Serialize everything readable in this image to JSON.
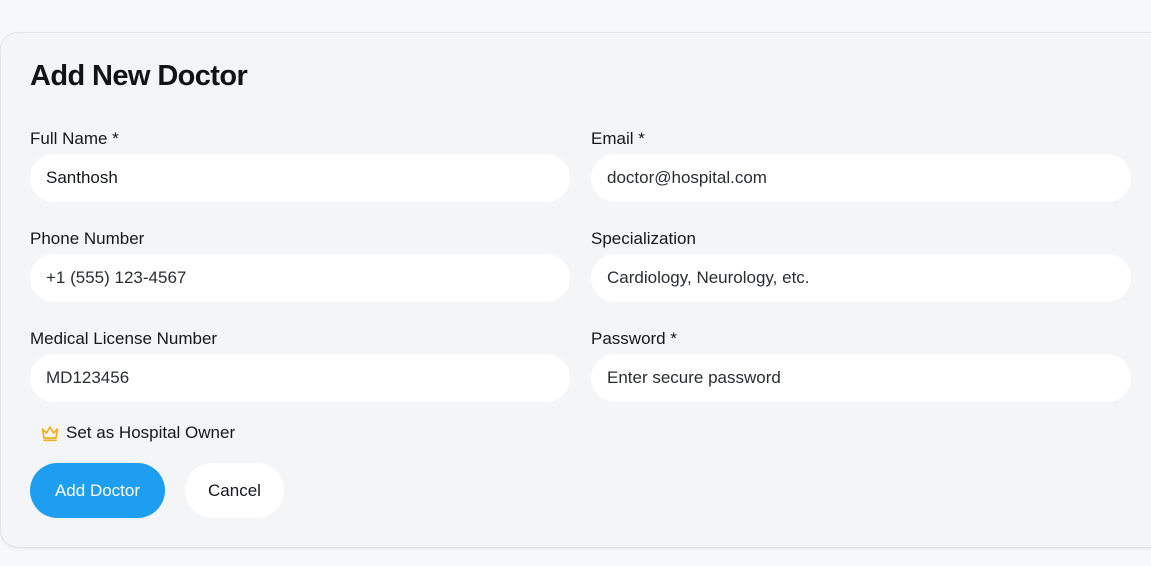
{
  "form": {
    "title": "Add New Doctor",
    "full_name": {
      "label": "Full Name *",
      "value": "Santhosh"
    },
    "email": {
      "label": "Email *",
      "placeholder": "doctor@hospital.com"
    },
    "phone": {
      "label": "Phone Number",
      "placeholder": "+1 (555) 123-4567"
    },
    "specialization": {
      "label": "Specialization",
      "placeholder": "Cardiology, Neurology, etc."
    },
    "license": {
      "label": "Medical License Number",
      "placeholder": "MD123456"
    },
    "password": {
      "label": "Password *",
      "placeholder": "Enter secure password"
    },
    "owner_toggle": {
      "label": "Set as Hospital Owner",
      "icon": "crown-icon"
    },
    "submit_label": "Add Doctor",
    "cancel_label": "Cancel"
  },
  "colors": {
    "primary": "#1e9ef0",
    "crown": "#f0b020"
  }
}
